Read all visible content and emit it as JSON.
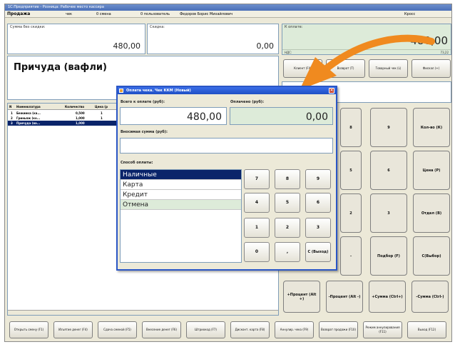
{
  "window": {
    "title": "1С:Предприятие - Розница: Рабочее место кассира"
  },
  "statusbar": {
    "title": "Продажа",
    "item1": "чек",
    "item2": "0 смена",
    "item3": "0 пользователь",
    "item4": "Федоров Борис Михайлович",
    "item5": "Кросс"
  },
  "fields": {
    "sum_without_discount": {
      "label": "Сумма без скидки:",
      "value": "480,00"
    },
    "discount": {
      "label": "Скидка:",
      "value": "0,00"
    },
    "to_pay": {
      "label": "К оплате:",
      "value": "480,00",
      "sub_left": "НДС:",
      "sub_right": "73,22"
    }
  },
  "product": {
    "name": "Причуда (вафли)"
  },
  "grid": {
    "columns": [
      "N",
      "Номенклатура",
      "Количество",
      "Цена (р"
    ],
    "rows": [
      {
        "n": "1",
        "name": "Бежинка (ка...",
        "qty": "0,500",
        "price": "1"
      },
      {
        "n": "2",
        "name": "Гриньяж (ко...",
        "qty": "1,000",
        "price": "1"
      },
      {
        "n": "3",
        "name": "Причуда (ва...",
        "qty": "1,000",
        "price": ""
      }
    ]
  },
  "side_buttons": {
    "row1": [
      "Клиент (F4)",
      "Возврат (T)",
      "Товарный чек (L)",
      "Фискал (+)"
    ],
    "keypad": [
      [
        "8",
        "9",
        "Кол-во (К)"
      ],
      [
        "5",
        "6",
        "Цена (P)"
      ],
      [
        "2",
        "3",
        "Отдел (B)"
      ],
      [
        "-",
        "Подбор (F)",
        "С(Выбор)"
      ],
      [
        "+Процент (Alt +)",
        "-Процент (Alt -)",
        "+Сумма (Ctrl+)",
        "-Сумма (Ctrl-)"
      ]
    ]
  },
  "bottom_buttons": [
    "Открыть смену (F1)",
    "Изъятие денег (F4)",
    "Сдача сменой (F5)",
    "Внесение денег (F6)",
    "Штрихкод (F7)",
    "Дисконт. карта (F8)",
    "Аннулир. чека (F9)",
    "Возврат продажи (F10)",
    "Режим аннулирования (F11)",
    "Выход (F12)"
  ],
  "dialog": {
    "title": "Оплата чека. Чек ККМ (Новый)",
    "to_pay_label": "Всего к оплате (руб):",
    "to_pay_value": "480,00",
    "paid_label": "Оплачено (руб):",
    "paid_value": "0,00",
    "entered_label": "Вносимая сумма (руб):",
    "entered_value": "",
    "payment_method_label": "Способ оплаты:",
    "payment_methods": [
      "Наличные",
      "Карта",
      "Кредит",
      "Отмена"
    ],
    "keypad": [
      "7",
      "8",
      "9",
      "4",
      "5",
      "6",
      "1",
      "2",
      "3",
      "0",
      ",",
      "С (Выход)"
    ]
  },
  "colors": {
    "window_bg": "#ece9d8",
    "titlebar": "#4a6fb8",
    "selection": "#0a246a",
    "to_pay_bg": "#ddebd9",
    "arrow": "#f08a1f"
  }
}
